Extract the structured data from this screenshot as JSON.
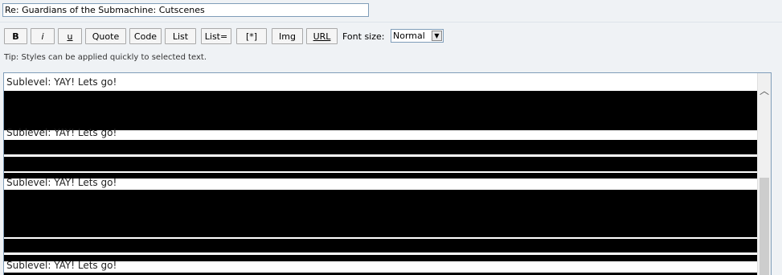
{
  "subject": {
    "value": "Re: Guardians of the Submachine: Cutscenes"
  },
  "toolbar": {
    "buttons": [
      {
        "label": "B"
      },
      {
        "label": "i"
      },
      {
        "label": "u"
      },
      {
        "label": "Quote"
      },
      {
        "label": "Code"
      },
      {
        "label": "List"
      },
      {
        "label": "List="
      },
      {
        "label": "[*]"
      },
      {
        "label": "Img"
      },
      {
        "label": "URL"
      }
    ],
    "font_size_label": "Font size:",
    "font_size_value": "Normal"
  },
  "tip": "Tip: Styles can be applied quickly to selected text.",
  "editor": {
    "lines": [
      "Sublevel: YAY! Lets go!",
      "Sublevel: YAY! Lets go!",
      "Sublevel: YAY! Lets go!",
      "Sublevel: YAY! Lets go!"
    ]
  }
}
